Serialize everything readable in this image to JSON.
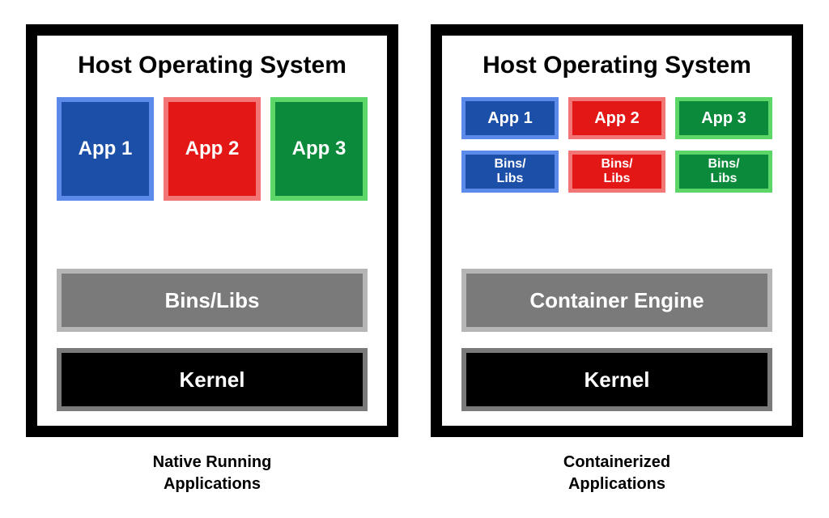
{
  "native": {
    "host_title": "Host Operating System",
    "apps": [
      "App 1",
      "App 2",
      "App 3"
    ],
    "middle": "Bins/Libs",
    "kernel": "Kernel",
    "caption_line1": "Native Running",
    "caption_line2": "Applications"
  },
  "containerized": {
    "host_title": "Host Operating System",
    "apps": [
      "App 1",
      "App 2",
      "App 3"
    ],
    "bins": [
      "Bins/\nLibs",
      "Bins/\nLibs",
      "Bins/\nLibs"
    ],
    "middle": "Container Engine",
    "kernel": "Kernel",
    "caption_line1": "Containerized",
    "caption_line2": "Applications"
  },
  "colors": {
    "blue_fill": "#1b4fa8",
    "blue_border": "#5c8aea",
    "red_fill": "#e41717",
    "red_border": "#f27676",
    "green_fill": "#0a8a3a",
    "green_border": "#5cd667",
    "gray_fill": "#7a7a7a",
    "gray_border": "#b5b5b5",
    "black": "#000000"
  }
}
